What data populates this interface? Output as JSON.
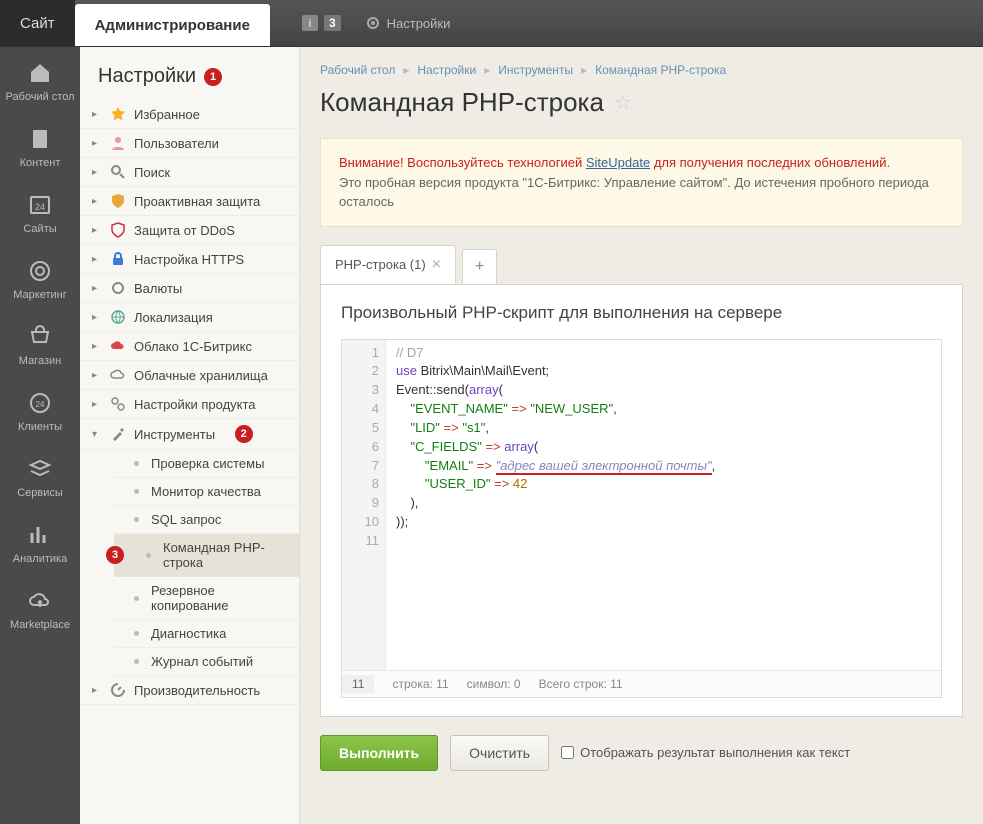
{
  "topbar": {
    "site_tab": "Сайт",
    "admin_tab": "Администрирование",
    "notif_count": "3",
    "settings_label": "Настройки"
  },
  "iconbar": [
    {
      "label": "Рабочий стол",
      "icon": "home"
    },
    {
      "label": "Контент",
      "icon": "doc"
    },
    {
      "label": "Сайты",
      "icon": "cal"
    },
    {
      "label": "Маркетинг",
      "icon": "target"
    },
    {
      "label": "Магазин",
      "icon": "cart"
    },
    {
      "label": "Клиенты",
      "icon": "clock"
    },
    {
      "label": "Сервисы",
      "icon": "layers"
    },
    {
      "label": "Аналитика",
      "icon": "chart"
    },
    {
      "label": "Marketplace",
      "icon": "cloud"
    }
  ],
  "sidebar": {
    "title": "Настройки",
    "badge1": "1",
    "items": [
      {
        "label": "Избранное",
        "icon": "star"
      },
      {
        "label": "Пользователи",
        "icon": "user"
      },
      {
        "label": "Поиск",
        "icon": "search"
      },
      {
        "label": "Проактивная защита",
        "icon": "shield"
      },
      {
        "label": "Защита от DDoS",
        "icon": "ddos"
      },
      {
        "label": "Настройка HTTPS",
        "icon": "lock"
      },
      {
        "label": "Валюты",
        "icon": "gear"
      },
      {
        "label": "Локализация",
        "icon": "globe"
      },
      {
        "label": "Облако 1С-Битрикс",
        "icon": "cloud1c"
      },
      {
        "label": "Облачные хранилища",
        "icon": "cloud2"
      },
      {
        "label": "Настройки продукта",
        "icon": "product"
      }
    ],
    "tools": {
      "label": "Инструменты",
      "badge": "2",
      "children": [
        {
          "label": "Проверка системы"
        },
        {
          "label": "Монитор качества"
        },
        {
          "label": "SQL запрос"
        },
        {
          "label": "Командная PHP-строка",
          "badge": "3",
          "active": true
        },
        {
          "label": "Резервное копирование"
        },
        {
          "label": "Диагностика"
        },
        {
          "label": "Журнал событий"
        }
      ]
    },
    "perf": {
      "label": "Производительность"
    }
  },
  "breadcrumb": [
    "Рабочий стол",
    "Настройки",
    "Инструменты",
    "Командная PHP-строка"
  ],
  "page_title": "Командная PHP-строка",
  "alert": {
    "warn_prefix": "Внимание! Воспользуйтесь технологией ",
    "link": "SiteUpdate",
    "warn_suffix": " для получения последних обновлений.",
    "trial": "Это пробная версия продукта \"1С-Битрикс: Управление сайтом\". До истечения пробного периода осталось"
  },
  "tab": {
    "label": "PHP-строка (1)"
  },
  "panel_title": "Произвольный PHP-скрипт для выполнения на сервере",
  "code": {
    "lines": [
      "1",
      "2",
      "3",
      "4",
      "5",
      "6",
      "7",
      "8",
      "9",
      "10",
      "11"
    ],
    "l1": "// D7",
    "l2a": "use",
    "l2b": " Bitrix\\Main\\Mail\\Event;",
    "l3a": "Event::send(",
    "l3b": "array",
    "l3c": "(",
    "l4a": "\"EVENT_NAME\"",
    "l4b": " => ",
    "l4c": "\"NEW_USER\"",
    "l5a": "\"LID\"",
    "l5b": " => ",
    "l5c": "\"s1\"",
    "l6a": "\"C_FIELDS\"",
    "l6b": " => ",
    "l6c": "array",
    "l6d": "(",
    "l7a": "\"EMAIL\"",
    "l7b": " => ",
    "l7c": "\"адрес вашей электронной почты\"",
    "l8a": "\"USER_ID\"",
    "l8b": " => ",
    "l8c": "42",
    "l9": "    ),",
    "l10": "));"
  },
  "status": {
    "pos": "11",
    "line": "строка: 11",
    "col": "символ: 0",
    "total": "Всего строк: 11"
  },
  "actions": {
    "run": "Выполнить",
    "clear": "Очистить",
    "as_text": "Отображать результат выполнения как текст"
  }
}
